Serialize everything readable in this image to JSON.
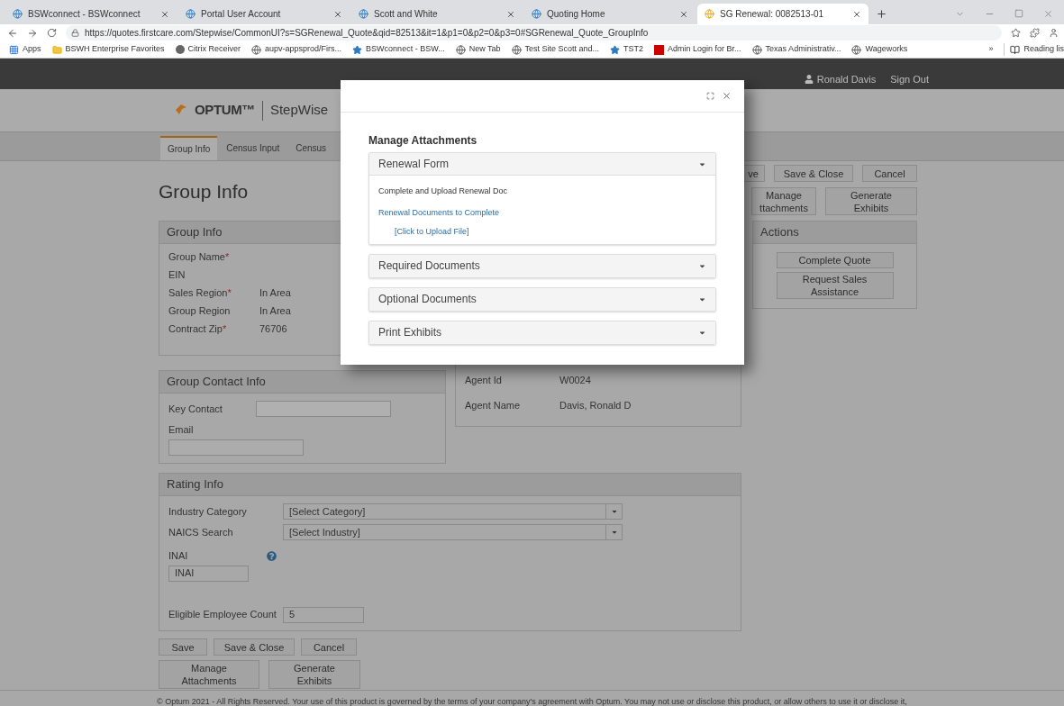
{
  "browser": {
    "tabs": [
      {
        "title": "BSWconnect - BSWconnect",
        "selected": false
      },
      {
        "title": "Portal User Account",
        "selected": false
      },
      {
        "title": "Scott and White",
        "selected": false
      },
      {
        "title": "Quoting Home",
        "selected": false
      },
      {
        "title": "SG Renewal: 0082513-01",
        "selected": true
      }
    ],
    "url": "https://quotes.firstcare.com/Stepwise/CommonUI?s=SGRenewal_Quote&qid=82513&it=1&p1=0&p2=0&p3=0#SGRenewal_Quote_GroupInfo",
    "bookmarks": [
      {
        "label": "Apps",
        "kind": "apps"
      },
      {
        "label": "BSWH Enterprise Favorites",
        "kind": "folder"
      },
      {
        "label": "Citrix Receiver",
        "kind": "site"
      },
      {
        "label": "aupv-appsprod/Firs...",
        "kind": "globe"
      },
      {
        "label": "BSWconnect - BSW...",
        "kind": "star"
      },
      {
        "label": "New Tab",
        "kind": "globe"
      },
      {
        "label": "Test Site Scott and...",
        "kind": "globe"
      },
      {
        "label": "TST2",
        "kind": "star"
      },
      {
        "label": "Admin Login for Br...",
        "kind": "badge"
      },
      {
        "label": "Texas Administrativ...",
        "kind": "globe"
      },
      {
        "label": "Wageworks",
        "kind": "globe"
      }
    ],
    "overflow": "»",
    "reading_list": "Reading lis"
  },
  "header": {
    "user": "Ronald Davis",
    "sign_out": "Sign Out",
    "brand": "OPTUM™",
    "product": "StepWise"
  },
  "nav_tabs": [
    {
      "label": "Group Info",
      "selected": true
    },
    {
      "label": "Census Input",
      "selected": false
    },
    {
      "label": "Census",
      "selected": false
    }
  ],
  "page_title": "Group Info",
  "top_buttons": [
    [
      "ve"
    ],
    [
      "Save & Close"
    ],
    [
      "Cancel"
    ]
  ],
  "top_buttons_2": [
    [
      "Manage",
      "ttachments"
    ],
    [
      "Generate",
      "Exhibits"
    ]
  ],
  "actions": {
    "title": "Actions",
    "buttons": [
      [
        "Complete Quote"
      ],
      [
        "Request Sales",
        "Assistance"
      ]
    ]
  },
  "group_info": {
    "title": "Group Info",
    "rows": [
      {
        "label": "Group Name",
        "marker": "*"
      },
      {
        "label": "EIN"
      },
      {
        "label": "Sales Region",
        "marker": "*",
        "value": "In Area"
      },
      {
        "label": "Group Region",
        "value": "In Area"
      },
      {
        "label": "Contract Zip",
        "marker": "*",
        "value": "76706"
      }
    ]
  },
  "contact": {
    "title": "Group Contact Info",
    "key_contact": "Key Contact",
    "email": "Email"
  },
  "agent": {
    "rows": [
      {
        "label": "Agent Id",
        "value": "W0024"
      },
      {
        "label": "Agent Name",
        "value": "Davis, Ronald D"
      }
    ]
  },
  "rating": {
    "title": "Rating Info",
    "selects": [
      {
        "label": "Industry Category",
        "value": "[Select Category]"
      },
      {
        "label": "NAICS Search",
        "value": "[Select Industry]"
      }
    ],
    "inai": {
      "label": "INAI",
      "value": "INAI"
    },
    "employees": {
      "label": "Eligible Employee Count",
      "value": "5"
    }
  },
  "bottom_buttons": [
    [
      "Save"
    ],
    [
      "Save & Close"
    ],
    [
      "Cancel"
    ]
  ],
  "bottom_buttons_2": [
    [
      "Manage",
      "Attachments"
    ],
    [
      "Generate",
      "Exhibits"
    ]
  ],
  "footer": "© Optum 2021 - All Rights Reserved. Your use of this product is governed by the terms of your company's agreement with Optum. You may not use or disclose this product, or allow others to use it or disclose it,",
  "modal": {
    "title": "Manage Attachments",
    "sections": [
      {
        "title": "Renewal Form",
        "expanded": true,
        "text": "Complete and Upload Renewal Doc",
        "link": "Renewal Documents to Complete",
        "upload": "[Click to Upload File]"
      },
      {
        "title": "Required Documents",
        "expanded": false
      },
      {
        "title": "Optional Documents",
        "expanded": false
      },
      {
        "title": "Print Exhibits",
        "expanded": false
      }
    ]
  }
}
